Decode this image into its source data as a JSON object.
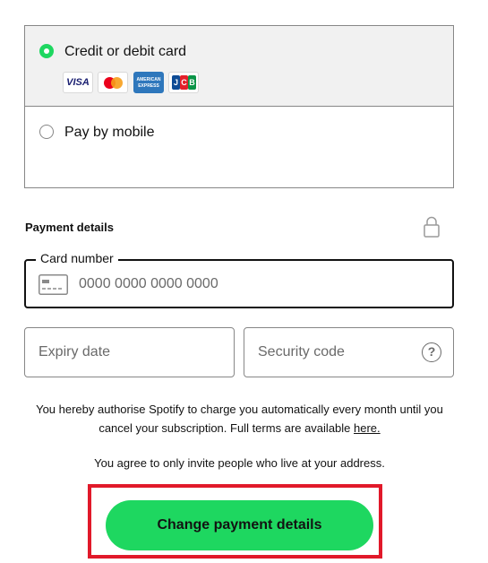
{
  "payment_methods": {
    "card_option": {
      "label": "Credit or debit card",
      "selected": true
    },
    "card_brands": [
      {
        "name": "visa-icon",
        "text": "VISA"
      },
      {
        "name": "mastercard-icon"
      },
      {
        "name": "american-express-icon",
        "text": "AMERICAN EXPRESS"
      },
      {
        "name": "jcb-icon",
        "text": "JCB"
      }
    ],
    "mobile_option": {
      "label": "Pay by mobile",
      "selected": false
    }
  },
  "payment_details": {
    "heading": "Payment details",
    "card_number": {
      "label": "Card number",
      "placeholder": "0000 0000 0000 0000",
      "value": ""
    },
    "expiry": {
      "placeholder": "Expiry date",
      "value": ""
    },
    "security_code": {
      "placeholder": "Security code",
      "value": ""
    },
    "help_icon": "?"
  },
  "terms": {
    "text": "You hereby authorise Spotify to charge you automatically every month until you cancel your subscription. Full terms are available ",
    "link_text": "here.",
    "invite_notice": "You agree to only invite people who live at your address."
  },
  "cta": {
    "label": "Change payment details"
  },
  "colors": {
    "accent": "#1ed760",
    "highlight_border": "#e1192a",
    "selected_option_bg": "#f1f1f1",
    "border": "#878787",
    "text": "#121212"
  }
}
